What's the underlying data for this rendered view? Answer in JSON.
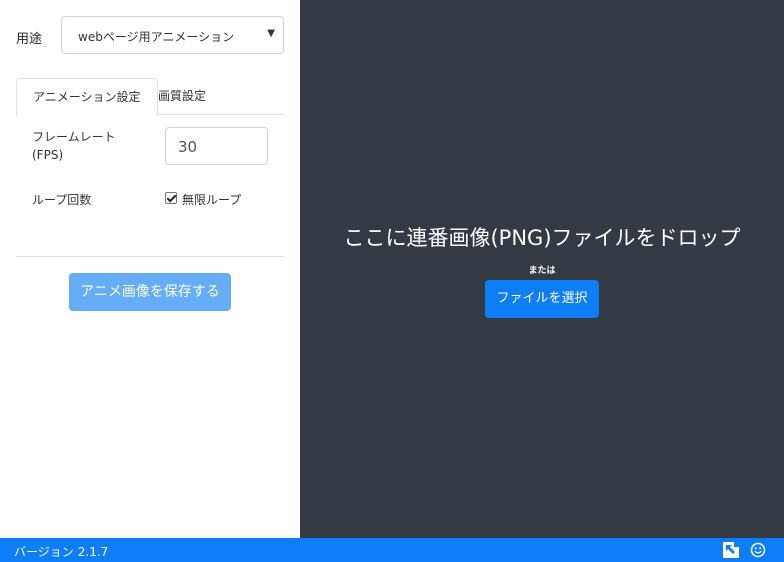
{
  "sidebar": {
    "usage_label": "用途",
    "usage_select_value": "webページ用アニメーション",
    "tabs": [
      {
        "label": "アニメーション設定",
        "active": true
      },
      {
        "label": "画質設定",
        "active": false
      }
    ],
    "fps_label_line1": "フレームレート",
    "fps_label_line2": "(FPS)",
    "fps_value": "30",
    "loop_label": "ループ回数",
    "loop_checkbox_label": "無限ループ",
    "loop_checked": true,
    "save_button_label": "アニメ画像を保存する"
  },
  "dropzone": {
    "title": "ここに連番画像(PNG)ファイルをドロップ",
    "or_text": "または",
    "select_button_label": "ファイルを選択"
  },
  "statusbar": {
    "version_label": "バージョン",
    "version_number": "2.1.7",
    "icons": [
      "share-icon",
      "smile-icon"
    ]
  },
  "colors": {
    "accent": "#0d7ef8",
    "dropzone_bg": "#343a44",
    "save_button_bg": "#66adf8"
  }
}
